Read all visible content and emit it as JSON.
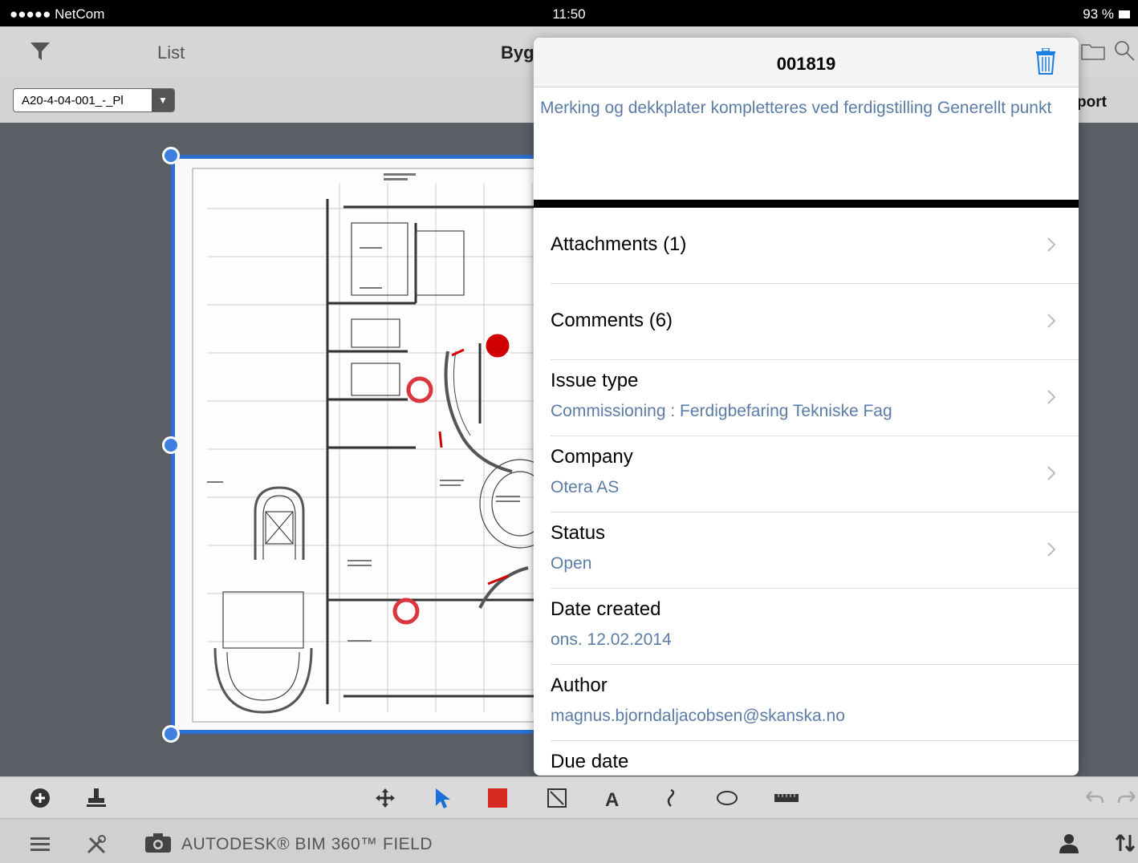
{
  "status_bar": {
    "carrier": "●●●●● NetCom",
    "time": "11:50",
    "battery": "93 %"
  },
  "top_bar": {
    "list_label": "List",
    "title": "Byg"
  },
  "sub_bar": {
    "sheet_value": "A20-4-04-001_-_Pl",
    "report_label": "port"
  },
  "issue": {
    "id": "001819",
    "description": "Merking og dekkplater kompletteres ved ferdigstilling Generellt punkt",
    "rows": [
      {
        "label": "Attachments (1)",
        "value": ""
      },
      {
        "label": "Comments (6)",
        "value": ""
      },
      {
        "label": "Issue type",
        "value": "Commissioning : Ferdigbefaring Tekniske Fag"
      },
      {
        "label": "Company",
        "value": "Otera AS"
      },
      {
        "label": "Status",
        "value": "Open"
      },
      {
        "label": "Date created",
        "value": "ons. 12.02.2014"
      },
      {
        "label": "Author",
        "value": "magnus.bjorndaljacobsen@skanska.no"
      },
      {
        "label": "Due date",
        "value": ""
      }
    ]
  },
  "bottom_bar": {
    "brand": "AUTODESK® BIM 360™ FIELD"
  },
  "colors": {
    "accent_blue": "#2c6fd1",
    "value_blue": "#5b7ca6",
    "issue_red": "#d00000"
  }
}
